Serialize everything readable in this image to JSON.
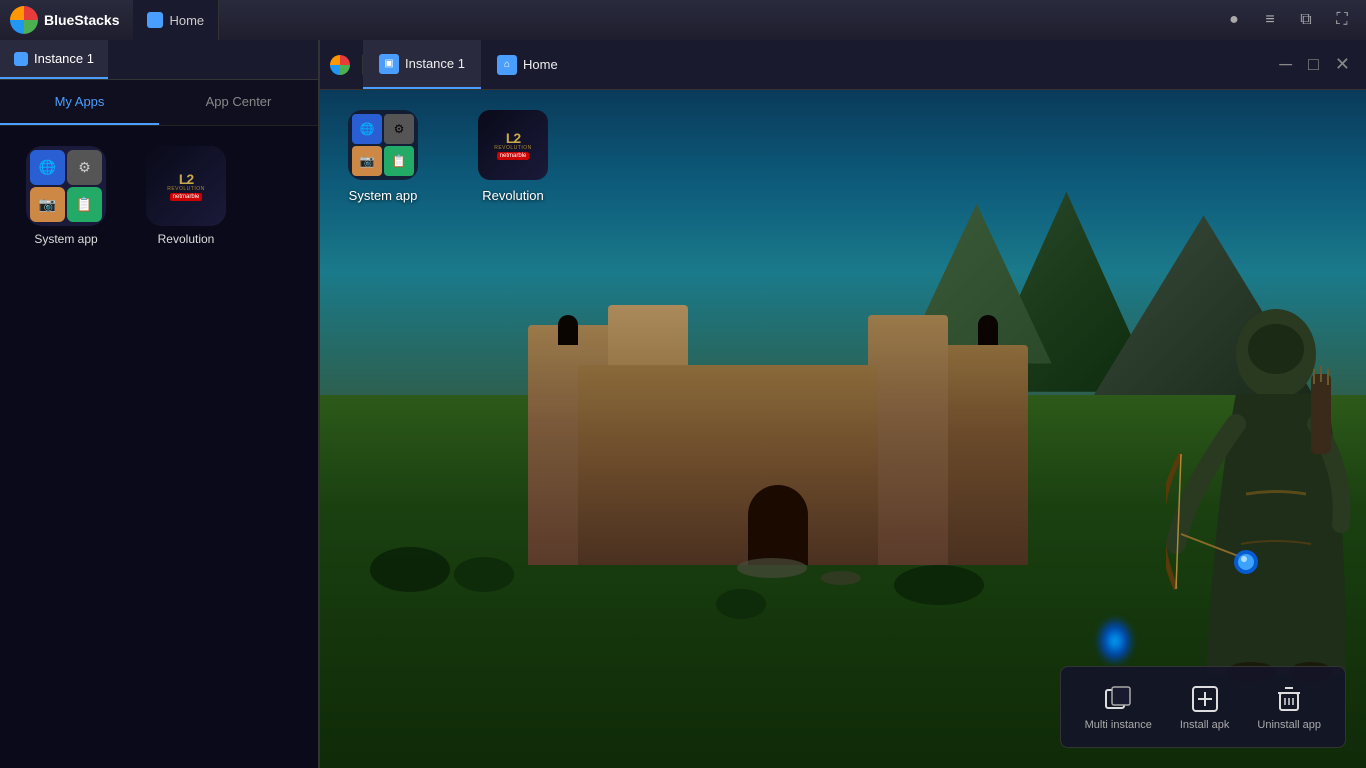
{
  "app": {
    "name": "BlueStacks",
    "title": "BlueStacks"
  },
  "titleBar": {
    "tabs": [
      {
        "id": "home",
        "label": "Home",
        "active": false
      }
    ],
    "instanceTab": {
      "label": "Instance 1",
      "active": true
    },
    "homeTab": {
      "label": "Home",
      "active": false
    }
  },
  "leftPanel": {
    "navTabs": [
      {
        "id": "my-apps",
        "label": "My Apps",
        "active": true
      },
      {
        "id": "app-center",
        "label": "App Center",
        "active": false
      }
    ],
    "apps": [
      {
        "id": "system-app",
        "label": "System app",
        "type": "system"
      },
      {
        "id": "revolution",
        "label": "Revolution",
        "type": "game"
      }
    ]
  },
  "instanceWindow": {
    "tabs": [
      {
        "id": "instance",
        "label": "Instance 1",
        "active": true
      },
      {
        "id": "home",
        "label": "Home",
        "active": false
      }
    ],
    "floatingApps": [
      {
        "id": "system-app",
        "label": "System app",
        "type": "system"
      },
      {
        "id": "revolution",
        "label": "Revolution",
        "type": "game"
      }
    ]
  },
  "bottomToolbar": {
    "buttons": [
      {
        "id": "multi-instance",
        "label": "Multi instance",
        "icon": "⬜"
      },
      {
        "id": "install-apk",
        "label": "Install apk",
        "icon": "⊕"
      },
      {
        "id": "uninstall-app",
        "label": "Uninstall app",
        "icon": "🗑"
      }
    ]
  },
  "icons": {
    "globe": "🌐",
    "gear": "⚙",
    "camera": "📷",
    "list": "📋",
    "minimize": "─",
    "maximize": "□",
    "close": "✕",
    "menu": "≡",
    "profile": "●"
  }
}
